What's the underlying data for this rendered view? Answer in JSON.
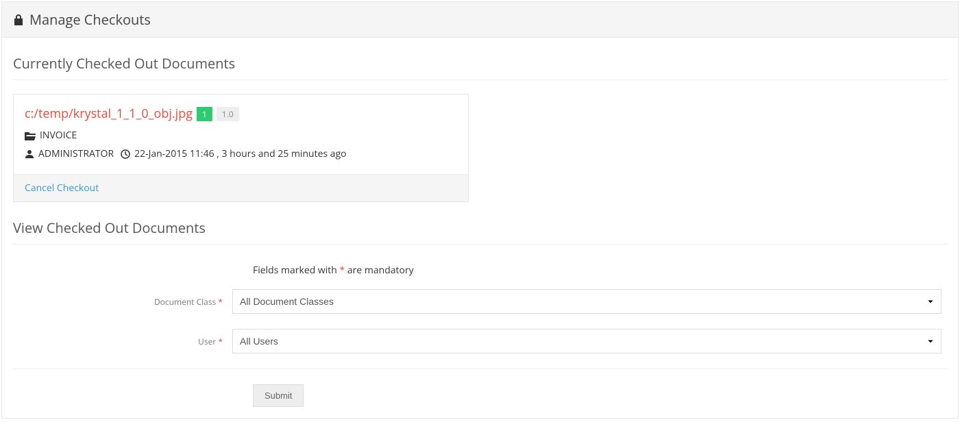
{
  "header": {
    "title": "Manage Checkouts"
  },
  "sections": {
    "currently_checked_out": "Currently Checked Out Documents",
    "view_checked_out": "View Checked Out Documents"
  },
  "document": {
    "title": "c:/temp/krystal_1_1_0_obj.jpg",
    "count_badge": "1",
    "version_badge": "1.0",
    "class": "INVOICE",
    "user": "ADMINISTRATOR",
    "timestamp": "22-Jan-2015 11:46 , 3 hours and 25 minutes ago",
    "cancel_label": "Cancel Checkout"
  },
  "form": {
    "mandatory_prefix": "Fields marked with ",
    "mandatory_suffix": " are mandatory",
    "document_class_label": "Document Class",
    "document_class_value": "All Document Classes",
    "user_label": "User",
    "user_value": "All Users",
    "submit_label": "Submit"
  }
}
